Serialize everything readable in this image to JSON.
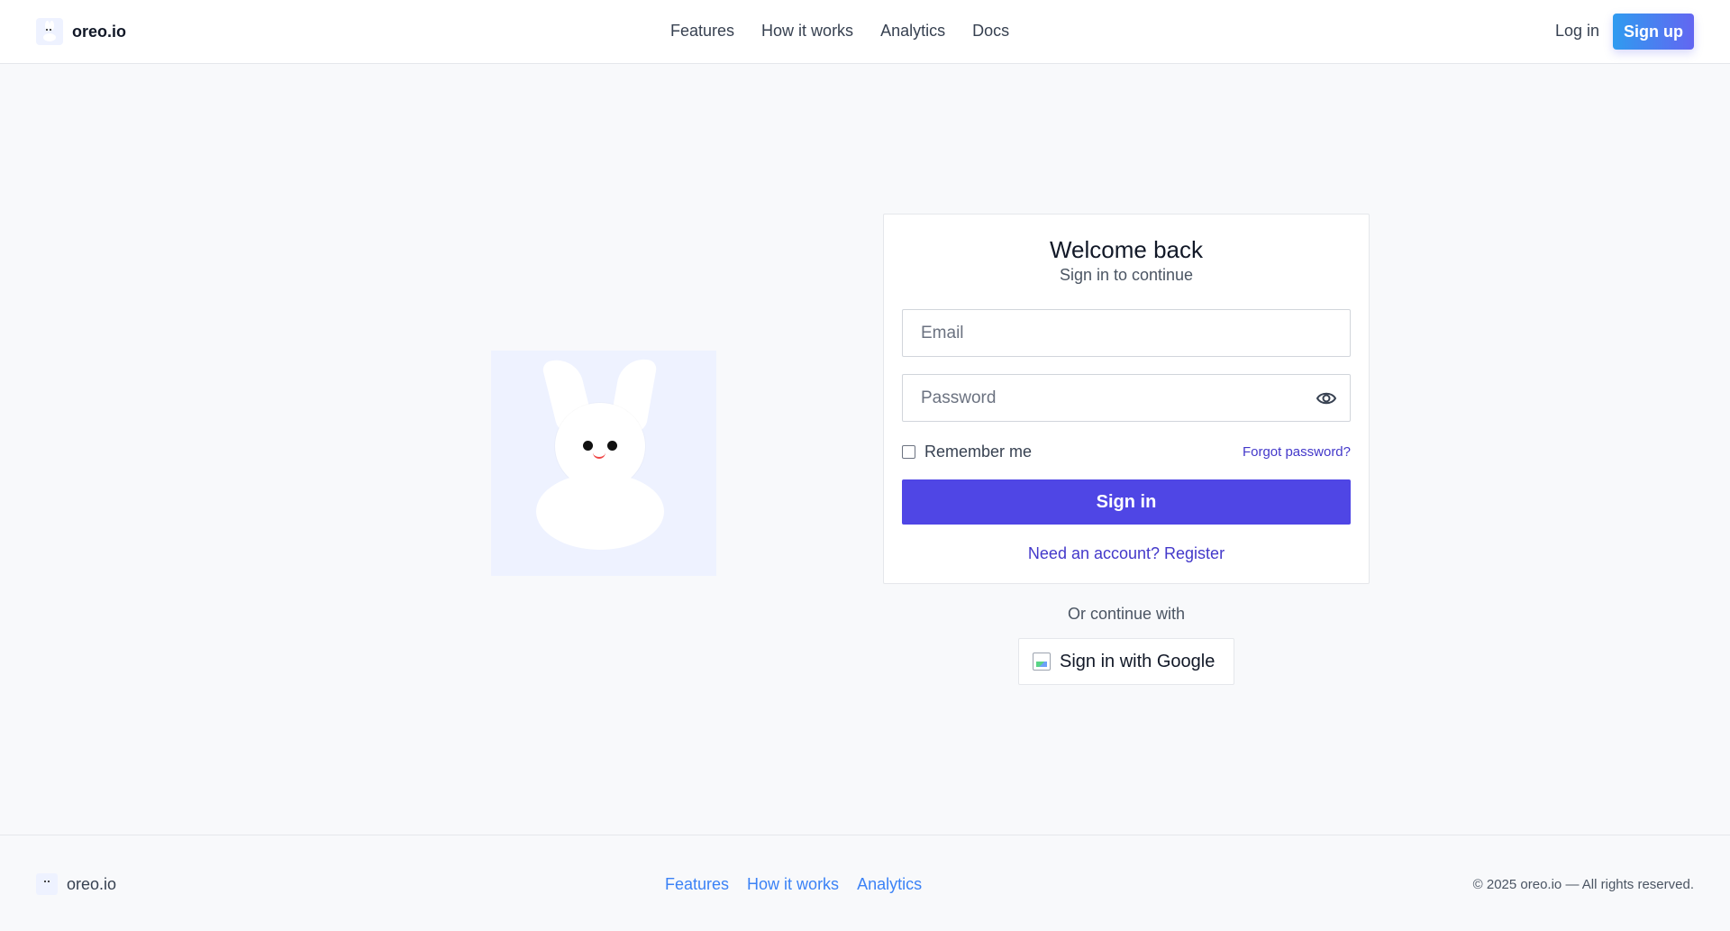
{
  "header": {
    "brand_name": "oreo.io",
    "nav_items": [
      "Features",
      "How it works",
      "Analytics",
      "Docs"
    ],
    "login_label": "Log in",
    "signup_label": "Sign up"
  },
  "login_card": {
    "title": "Welcome back",
    "subtitle": "Sign in to continue",
    "email_placeholder": "Email",
    "password_placeholder": "Password",
    "remember_label": "Remember me",
    "forgot_label": "Forgot password?",
    "signin_label": "Sign in",
    "register_label": "Need an account? Register"
  },
  "social": {
    "or_label": "Or continue with",
    "google_label": "Sign in with Google"
  },
  "footer": {
    "brand_name": "oreo.io",
    "links": [
      "Features",
      "How it works",
      "Analytics"
    ],
    "copyright": "© 2025 oreo.io — All rights reserved."
  },
  "colors": {
    "primary": "#4f46e5",
    "link": "#4338ca",
    "footer_link": "#3b82f6",
    "signup_gradient_start": "#2f9bf0",
    "signup_gradient_end": "#6366f1",
    "illustration_bg": "#eef2ff"
  },
  "icons": {
    "password_toggle": "eye-icon",
    "google": "google-icon",
    "brand": "bunny-logo-icon"
  }
}
